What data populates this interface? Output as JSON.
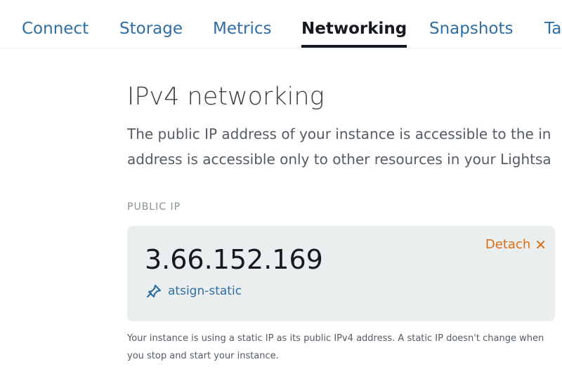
{
  "tabs": [
    {
      "label": "Connect"
    },
    {
      "label": "Storage"
    },
    {
      "label": "Metrics"
    },
    {
      "label": "Networking",
      "active": true
    },
    {
      "label": "Snapshots"
    },
    {
      "label": "Ta"
    }
  ],
  "section": {
    "title": "IPv4 networking",
    "description_line1": "The public IP address of your instance is accessible to the in",
    "description_line2": "address is accessible only to other resources in your Lightsa"
  },
  "public_ip": {
    "label": "PUBLIC IP",
    "address": "3.66.152.169",
    "static_ip_name": "atsign-static",
    "detach_label": "Detach",
    "note": "Your instance is using a static IP as its public IPv4 address. A static IP doesn't change when you stop and start your instance."
  },
  "colors": {
    "link": "#2f6ea3",
    "accent_orange": "#dd6b10",
    "card_bg": "#ebeeef"
  }
}
